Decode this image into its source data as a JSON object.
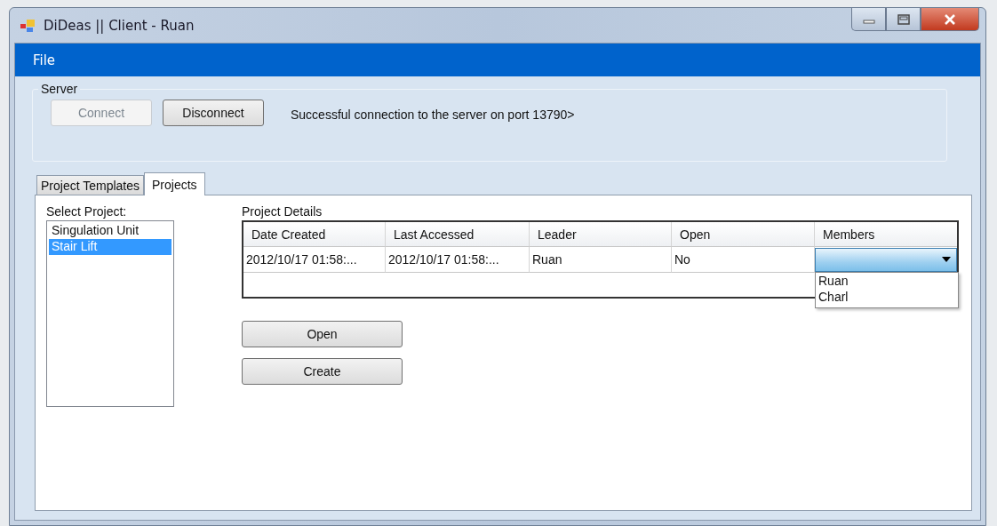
{
  "window": {
    "title": "DiDeas || Client - Ruan"
  },
  "menu": [
    "File"
  ],
  "server": {
    "label": "Server",
    "buttons": [
      {
        "label": "Connect",
        "disabled": true
      },
      {
        "label": "Disconnect",
        "disabled": false
      }
    ],
    "status": "Successful connection to the server on port 13790>"
  },
  "tabs": [
    {
      "label": "Project Templates",
      "selected": false
    },
    {
      "label": "Projects",
      "selected": true
    }
  ],
  "project_list": {
    "label": "Select Project:",
    "items": [
      {
        "label": "Singulation Unit",
        "selected": false
      },
      {
        "label": "Stair Lift",
        "selected": true
      }
    ]
  },
  "details": {
    "label": "Project Details",
    "columns": [
      "Date Created",
      "Last Accessed",
      "Leader",
      "Open",
      "Members"
    ],
    "rows": [
      {
        "cells": [
          "2012/10/17 01:58:...",
          "2012/10/17 01:58:...",
          "Ruan",
          "No"
        ],
        "members": {
          "expanded": true,
          "options": [
            "Ruan",
            "Charl"
          ]
        }
      }
    ]
  },
  "actions": [
    "Open",
    "Create"
  ]
}
